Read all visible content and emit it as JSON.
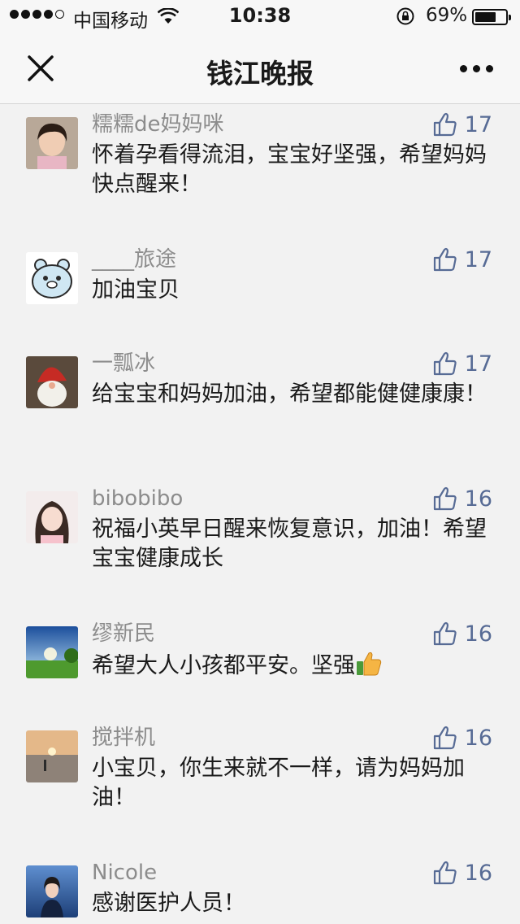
{
  "status_bar": {
    "carrier": "中国移动",
    "time": "10:38",
    "battery_percent": "69%",
    "battery_level": 0.69
  },
  "nav": {
    "title": "钱江晚报",
    "close_icon": "close-icon",
    "more_icon": "more-icon"
  },
  "comments": [
    {
      "name": "糯糯de妈妈咪",
      "text": "怀着孕看得流泪，宝宝好坚强，希望妈妈快点醒来！",
      "likes": "17",
      "avatar": "avatar-child-photo"
    },
    {
      "name": "____旅途",
      "text": "加油宝贝",
      "likes": "17",
      "avatar": "avatar-cartoon-bear"
    },
    {
      "name": "一瓢冰",
      "text": "给宝宝和妈妈加油，希望都能健健康康！",
      "likes": "17",
      "avatar": "avatar-santa-doll"
    },
    {
      "name": "bibobibo",
      "text": "祝福小英早日醒来恢复意识，加油！希望宝宝健康成长",
      "likes": "16",
      "avatar": "avatar-girl-photo"
    },
    {
      "name": "缪新民",
      "text": "希望大人小孩都平安。坚强",
      "text_emoji": "thumbs-up-emoji",
      "likes": "16",
      "avatar": "avatar-landscape"
    },
    {
      "name": "搅拌机",
      "text": "小宝贝，你生来就不一样，请为妈妈加油！",
      "likes": "16",
      "avatar": "avatar-sunset-beach"
    },
    {
      "name": "Nicole",
      "text": "感谢医护人员！",
      "likes": "16",
      "avatar": "avatar-woman-photo"
    }
  ],
  "colors": {
    "background": "#f2f2f2",
    "name_gray": "#8c8c8c",
    "like_blue": "#576b95"
  }
}
